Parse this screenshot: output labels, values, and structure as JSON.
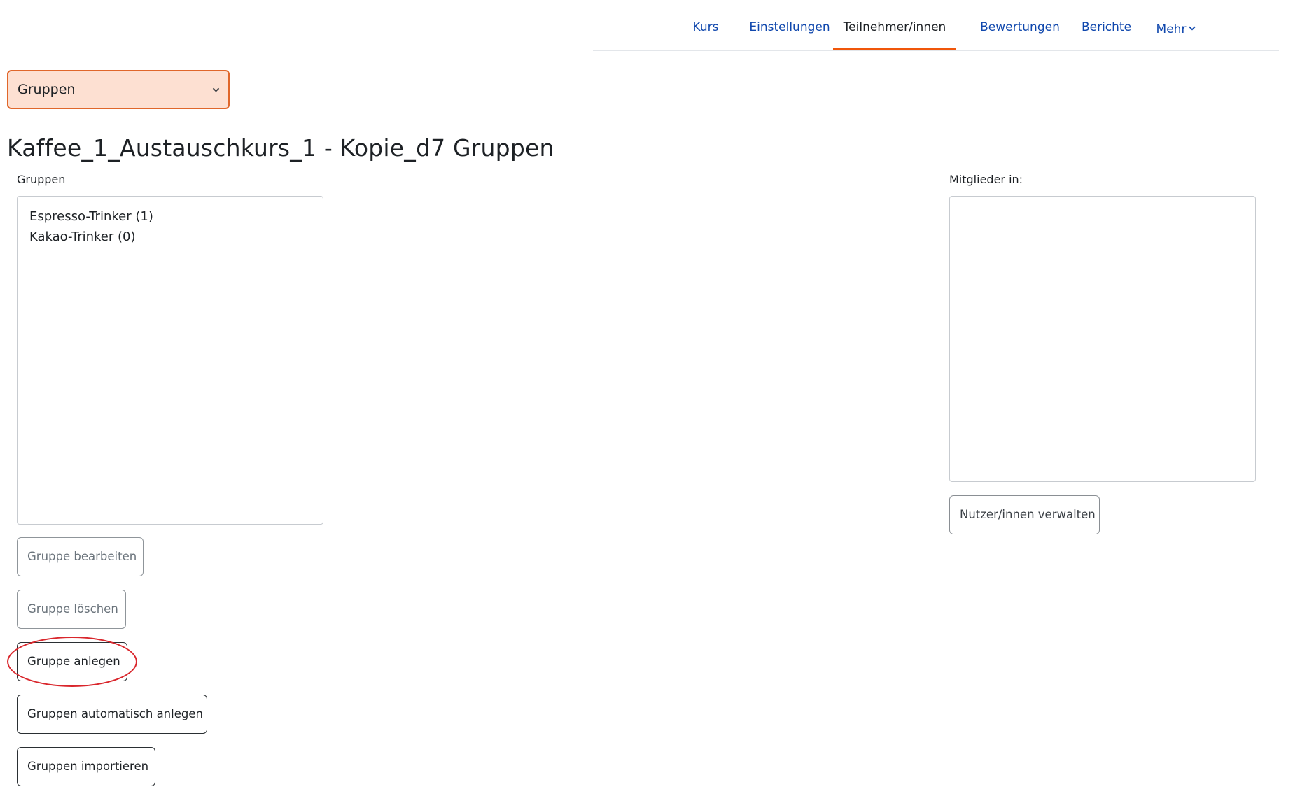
{
  "nav": {
    "items": [
      {
        "label": "Kurs"
      },
      {
        "label": "Einstellungen"
      },
      {
        "label": "Teilnehmer/innen"
      },
      {
        "label": "Bewertungen"
      },
      {
        "label": "Berichte"
      },
      {
        "label": "Mehr"
      }
    ],
    "active_index": 2
  },
  "tertiary_select": {
    "selected": "Gruppen"
  },
  "page_title": "Kaffee_1_Austauschkurs_1 - Kopie_d7 Gruppen",
  "groups_panel": {
    "label": "Gruppen",
    "options": [
      "Espresso-Trinker (1)",
      "Kakao-Trinker (0)"
    ]
  },
  "members_panel": {
    "label": "Mitglieder in:",
    "options": []
  },
  "buttons": {
    "edit_group": "Gruppe bearbeiten",
    "delete_group": "Gruppe löschen",
    "create_group": "Gruppe anlegen",
    "auto_create": "Gruppen automatisch anlegen",
    "import_groups": "Gruppen importieren",
    "manage_users": "Nutzer/innen verwalten"
  },
  "colors": {
    "link": "#0f47ad",
    "accent": "#f0560a",
    "select_bg": "#fde0d2",
    "annotation": "#d9262c"
  }
}
